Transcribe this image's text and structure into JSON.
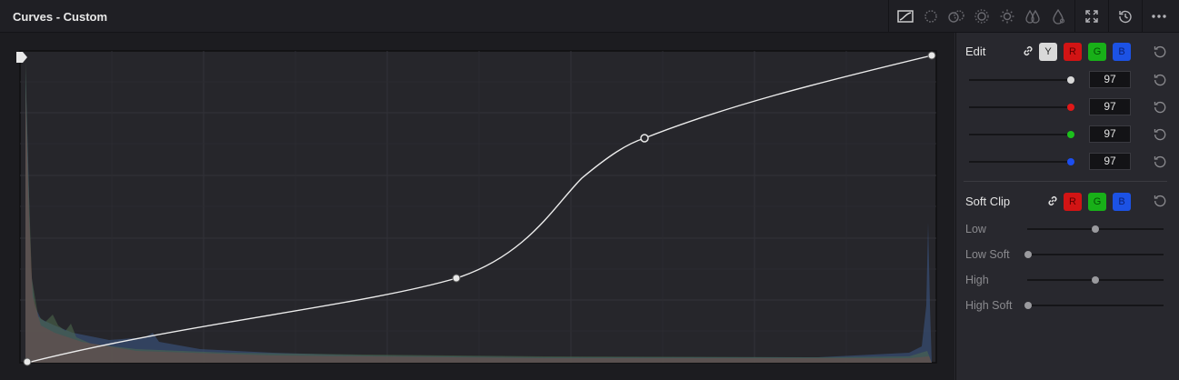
{
  "header": {
    "title": "Curves - Custom"
  },
  "toolbar": {
    "icons": [
      "curve-icon",
      "dotted-circle-icon",
      "dual-circle-icon",
      "sun-dotted-icon",
      "sun-icon",
      "drops-icon",
      "drop-icon",
      "expand-icon",
      "history-icon",
      "more-icon"
    ]
  },
  "edit": {
    "label": "Edit",
    "channels": [
      "Y",
      "R",
      "G",
      "B"
    ],
    "sliders": [
      {
        "name": "y",
        "value": "97",
        "color": "#d8d8d8"
      },
      {
        "name": "r",
        "value": "97",
        "color": "#e01818"
      },
      {
        "name": "g",
        "value": "97",
        "color": "#1cc01c"
      },
      {
        "name": "b",
        "value": "97",
        "color": "#1c4ef0"
      }
    ]
  },
  "soft_clip": {
    "label": "Soft Clip",
    "channels": [
      "R",
      "G",
      "B"
    ],
    "rows": [
      {
        "label": "Low",
        "value": 0.5
      },
      {
        "label": "Low Soft",
        "value": 0.0
      },
      {
        "label": "High",
        "value": 0.5
      },
      {
        "label": "High Soft",
        "value": 0.0
      }
    ]
  },
  "colors": {
    "accent_white": "#e8e8e8",
    "red": "#e01818",
    "green": "#1cc01c",
    "blue": "#1c4ef0"
  }
}
